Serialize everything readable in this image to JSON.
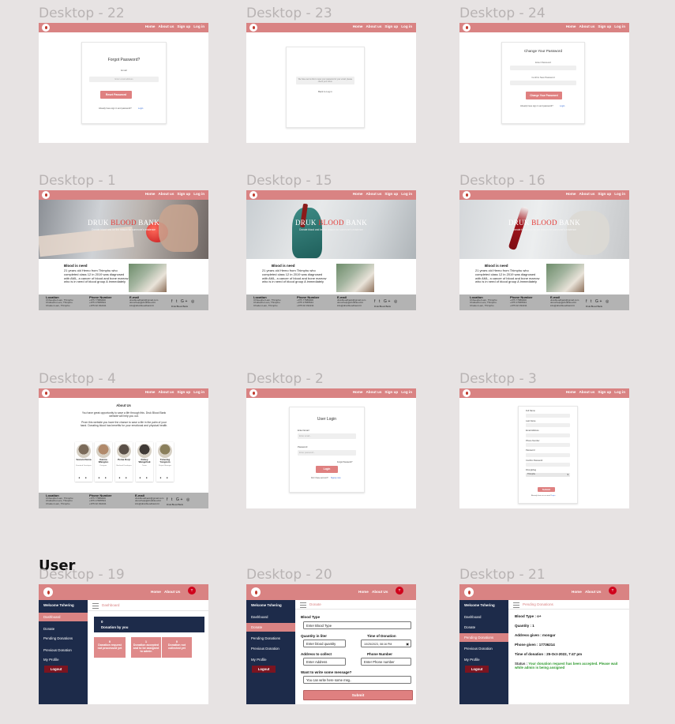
{
  "section_user": "User",
  "nav": {
    "home": "Home",
    "about": "About us",
    "signup": "Sign up",
    "login": "Log in"
  },
  "nav_user": {
    "home": "Home",
    "about": "About Us",
    "avatar_initial": "T"
  },
  "frames": {
    "d22": {
      "label": "Desktop - 22",
      "title": "Forgot Password?",
      "email_label": "Email",
      "email_placeholder": "Enter email address",
      "button": "Reset Password",
      "footer_text": "Already have sign in and password?",
      "footer_link": "Login"
    },
    "d23": {
      "label": "Desktop - 23",
      "message": "We have sent a link to reset your password to your email, please check your inbox.",
      "back": "Back to Log in"
    },
    "d24": {
      "label": "Desktop - 24",
      "title": "Change Your Password",
      "new_label": "Enter Password",
      "confirm_label": "Confirm New Password",
      "button": "Change Your Password",
      "footer_text": "Already have sign in and password?",
      "footer_link": "Login"
    },
    "d1": {
      "label": "Desktop - 1"
    },
    "d15": {
      "label": "Desktop - 15"
    },
    "d16": {
      "label": "Desktop - 16"
    },
    "d4": {
      "label": "Desktop - 4",
      "title": "About Us",
      "p1": "You have great opportunity to save a life through this. Druk Blood Bank website will help you out.",
      "p2": "Prom this website you have the chance to save a life in the palm of your hand. Donating blood has benefits for your emotional and physical health."
    },
    "d2": {
      "label": "Desktop - 2",
      "title": "User Login",
      "email_label": "Enter Email",
      "email_placeholder": "Enter email...",
      "password_label": "Password",
      "password_placeholder": "Enter password...",
      "forgot": "Forgot Password?",
      "button": "Login",
      "footer_text": "Don't have account?",
      "footer_link": "Signup now"
    },
    "d3": {
      "label": "Desktop - 3",
      "fields": [
        "Full Name",
        "Last Name",
        "Email Address",
        "Phone Number",
        "Password",
        "Confirm Password",
        "Dzongkhag"
      ],
      "select_value": "Thimphu",
      "button": "Submit",
      "footer_text": "Already have an account?",
      "footer_link": "Login"
    },
    "d19": {
      "label": "Desktop - 19"
    },
    "d20": {
      "label": "Desktop - 20"
    },
    "d21": {
      "label": "Desktop - 21"
    }
  },
  "hero": {
    "brand_a": "DRUK ",
    "brand_b": "BLOOD",
    "brand_c": " BANK",
    "tagline": "Donate blood and be the reason for someone's existence"
  },
  "story": {
    "heading": "Blood is need",
    "text": "21 years old Hemo from Thimphu who completed class 12 in 2019 was diagnosed with AML, a cancer of blood and bone marrow who is in need of blood group A immediately"
  },
  "footer": {
    "location_title": "Location",
    "location_lines": [
      "Chhoephel Lam, Thimphu",
      "Chubachu Lam, Thimphu",
      "Choden Lam, Thimphu"
    ],
    "phone_title": "Phone Number",
    "phone_lines": [
      "+975 77889900",
      "+975 17665544",
      "+975 02 332211"
    ],
    "email_title": "E-mail",
    "email_lines": [
      "drukbloodbank@gmail.com",
      "donorhelp@drukblood.bt",
      "info@drukbloodbank.bt"
    ],
    "social_icons": "f t G+ ◎",
    "social_caption": "Druk Blood Bank"
  },
  "members": [
    {
      "name": "Sonam Dema",
      "role": "Frontend Developer",
      "color": "#7b6b5a"
    },
    {
      "name": "Karma Wangmo",
      "role": "Designer",
      "color": "#b18a6b"
    },
    {
      "name": "Pema Dorji",
      "role": "Backend Developer",
      "color": "#5a5048"
    },
    {
      "name": "Kinley Wangchuk",
      "role": "Tester",
      "color": "#3f3a36"
    },
    {
      "name": "Tshering Yangzom",
      "role": "Project Manager",
      "color": "#8a7f5c"
    }
  ],
  "sidebar": {
    "welcome": "Welcome Tshering",
    "items": [
      "Dashboard",
      "Donate",
      "Pending Donations",
      "Previous Donation",
      "My Profile"
    ],
    "logout": "Logout"
  },
  "dashboard": {
    "subheader": "Dashboard",
    "summary_count": "0",
    "summary_label": "Donation by you",
    "stats": [
      {
        "count": "0",
        "label": "Donation request not processed yet"
      },
      {
        "count": "1",
        "label": "Donation accepted and to be assigned to admin"
      },
      {
        "count": "0",
        "label": "Donation not collected yet"
      }
    ]
  },
  "donate_form": {
    "subheader": "Donate",
    "blood_type_label": "Blood Type",
    "blood_type_value": "Enter Blood Type",
    "quantity_label": "Quantity in liter",
    "quantity_value": "Enter blood quantity",
    "time_label": "Time of Donation",
    "time_value": "10/25/2023, 08:16 PM",
    "address_label": "Address to collect",
    "address_value": "Enter Address",
    "phone_label": "Phone Number",
    "phone_value": "Enter Phone number",
    "message_label": "Want to write some message?",
    "message_value": "You can write here some msg..",
    "submit": "Submit"
  },
  "pending": {
    "subheader": "Pending Donations",
    "lines": [
      "Blood Type : o+",
      "Quantity : 1",
      "Address given : mongar",
      "Phone given : 17736214",
      "Time of donation : 25-Oct-2022, 7:47 pm"
    ],
    "status_label": "Status : ",
    "status_text": "Your donation request has been accepted. Please wait while admin is being assigned",
    "status_color": "#2e9a2e"
  }
}
